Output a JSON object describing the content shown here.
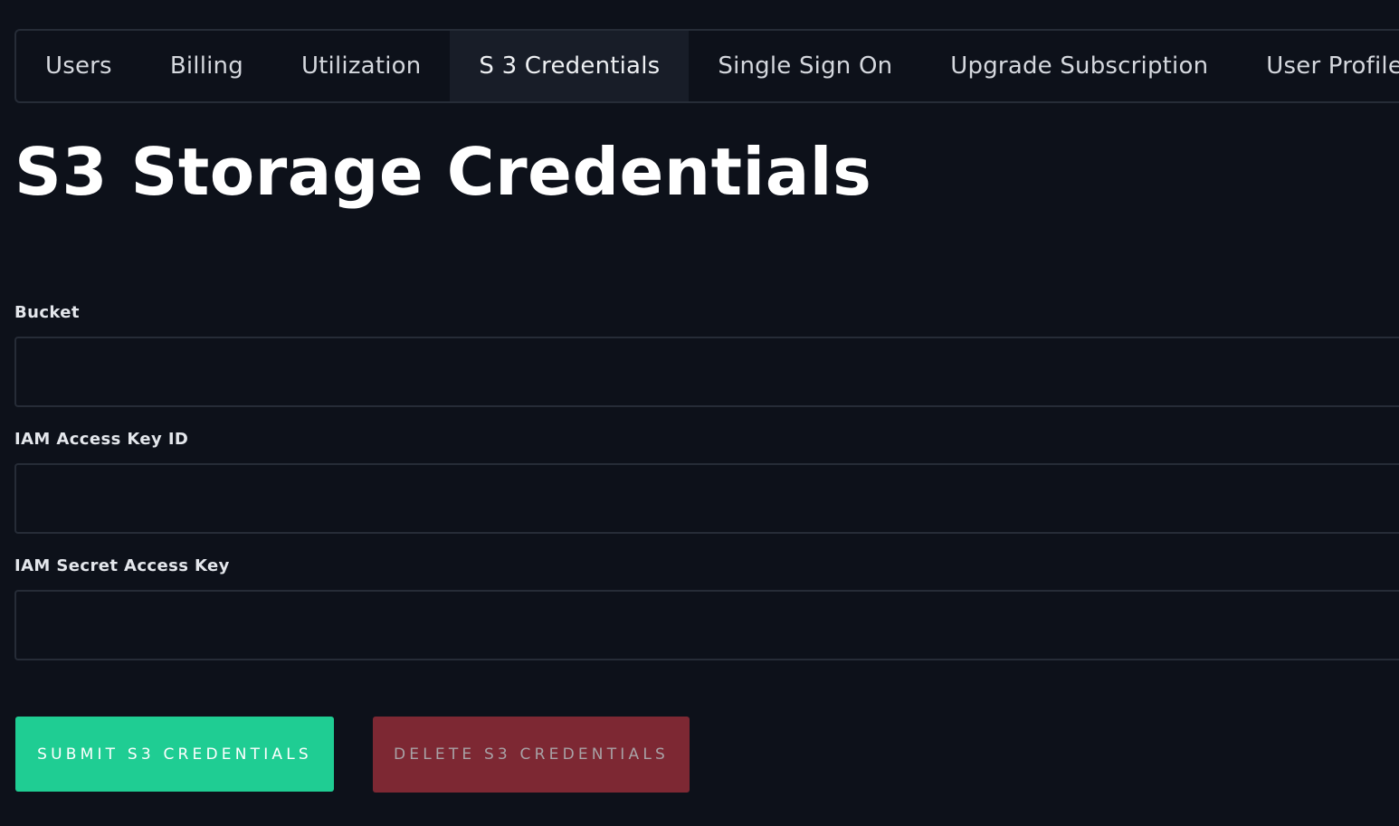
{
  "tabs": [
    {
      "label": "Users"
    },
    {
      "label": "Billing"
    },
    {
      "label": "Utilization"
    },
    {
      "label": "S 3 Credentials"
    },
    {
      "label": "Single Sign On"
    },
    {
      "label": "Upgrade Subscription"
    },
    {
      "label": "User Profile"
    }
  ],
  "active_tab": "S 3 Credentials",
  "page": {
    "title": "S3 Storage Credentials"
  },
  "form": {
    "bucket_label": "Bucket",
    "bucket_value": "",
    "access_key_label": "IAM Access Key ID",
    "access_key_value": "",
    "secret_key_label": "IAM Secret Access Key",
    "secret_key_value": ""
  },
  "buttons": {
    "submit_label": "SUBMIT S3 CREDENTIALS",
    "delete_label": "DELETE S3 CREDENTIALS"
  },
  "icons": {
    "user_profile": "external-link-icon"
  },
  "colors": {
    "background": "#0d111a",
    "active_tab": "#181d28",
    "submit": "#1fcd93",
    "delete": "#7d2833"
  }
}
